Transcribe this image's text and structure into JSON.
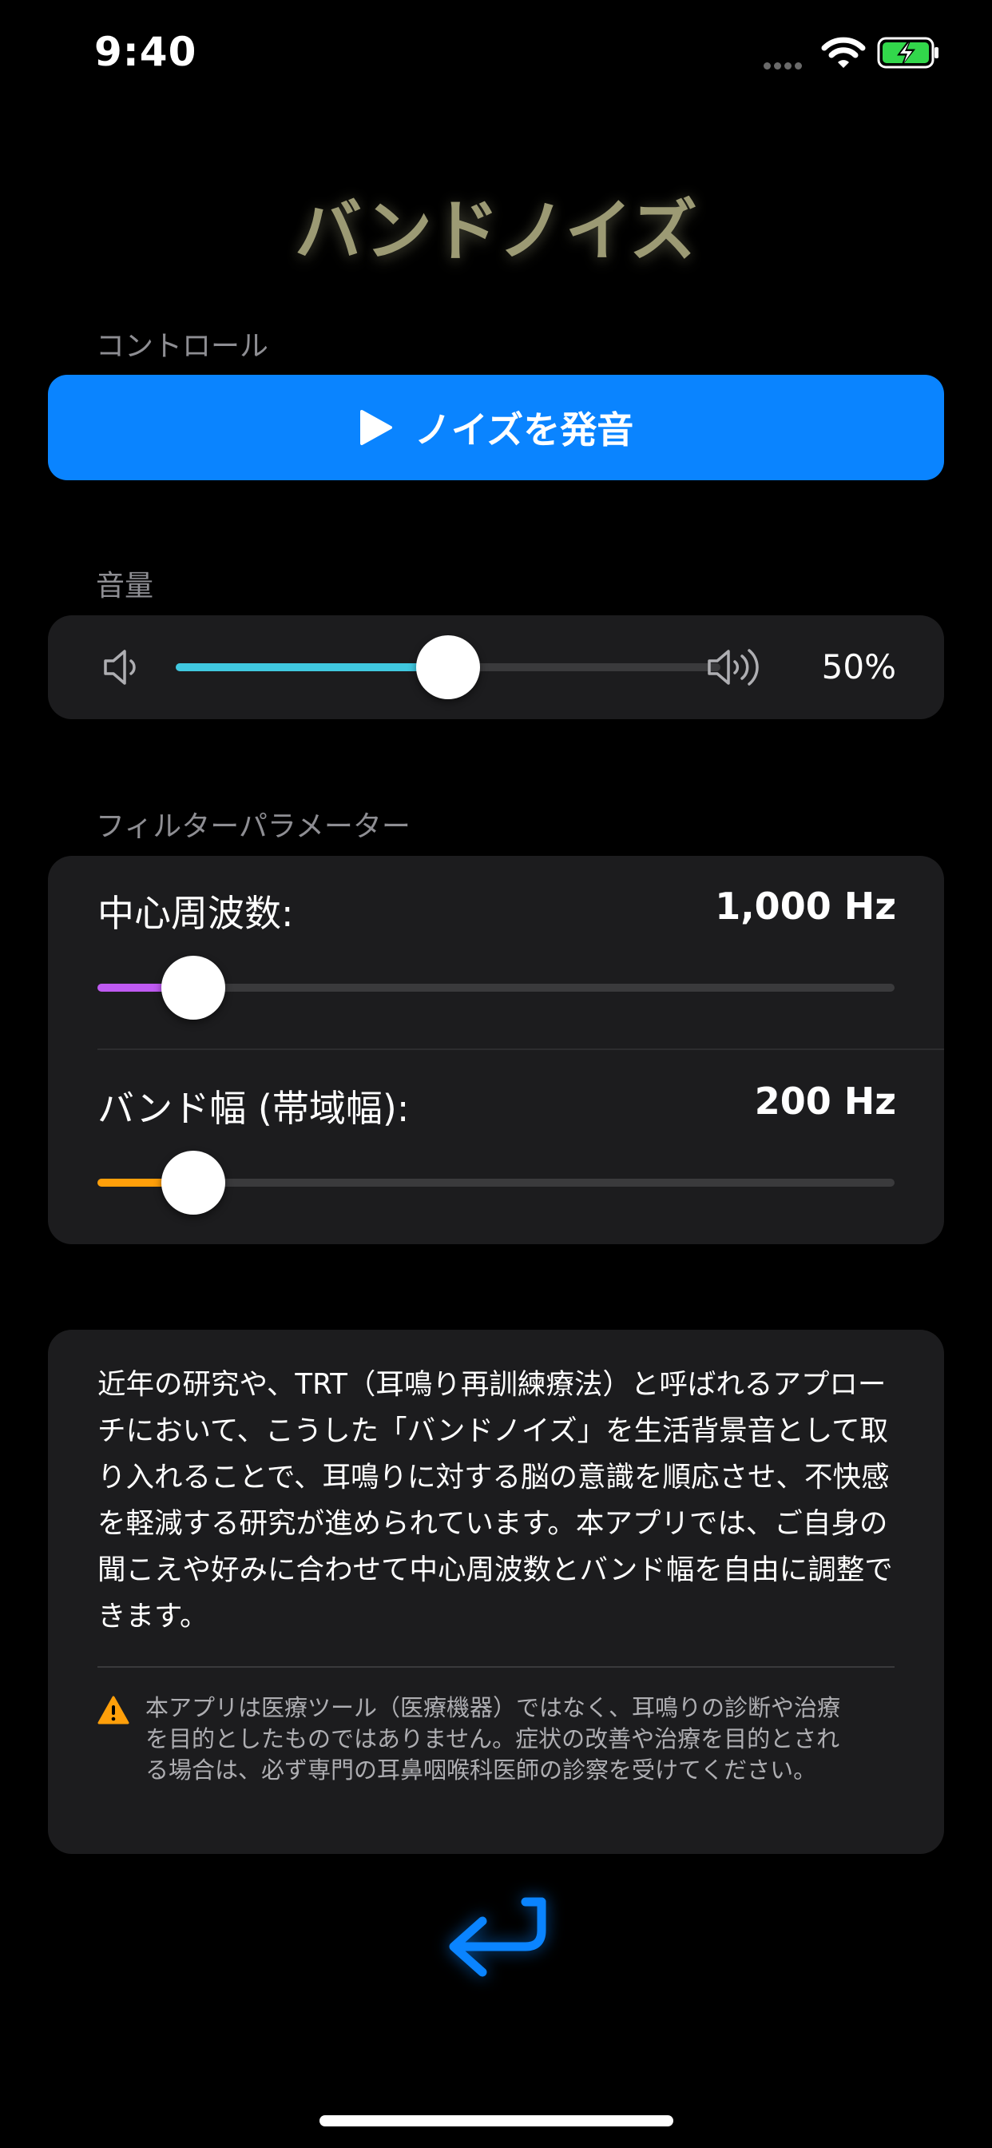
{
  "status_bar": {
    "time": "9:40"
  },
  "app": {
    "title": "バンドノイズ"
  },
  "controls": {
    "section_label": "コントロール",
    "play_button_label": "ノイズを発音"
  },
  "volume": {
    "section_label": "音量",
    "value_text": "50%",
    "level": 0.5
  },
  "filter": {
    "section_label": "フィルターパラメーター",
    "center_frequency": {
      "label": "中心周波数:",
      "value_text": "1,000 Hz",
      "level": 0.12,
      "color": "#bf5af2"
    },
    "bandwidth": {
      "label": "バンド幅 (帯域幅):",
      "value_text": "200 Hz",
      "level": 0.12,
      "color": "#ff9f0a"
    }
  },
  "info": {
    "paragraph": "近年の研究や、TRT（耳鳴り再訓練療法）と呼ばれるアプローチにおいて、こうした「バンドノイズ」を生活背景音として取り入れることで、耳鳴りに対する脳の意識を順応させ、不快感を軽減する研究が進められています。本アプリでは、ご自身の聞こえや好みに合わせて中心周波数とバンド幅を自由に調整できます。",
    "warning": "本アプリは医療ツール（医療機器）ではなく、耳鳴りの診断や治療を目的としたものではありません。症状の改善や治療を目的とされる場合は、必ず専門の耳鼻咽喉科医師の診察を受けてください。"
  },
  "colors": {
    "accent": "#0a84ff",
    "volume_fill": "#40c8e0",
    "card": "#1c1c1e",
    "title": "#9c9a74",
    "warning": "#ff9f0a"
  },
  "icons": {
    "play": "play-icon",
    "speaker_low": "speaker-low-icon",
    "speaker_high": "speaker-high-icon",
    "warning": "warning-triangle-icon",
    "back": "return-arrow-icon"
  }
}
